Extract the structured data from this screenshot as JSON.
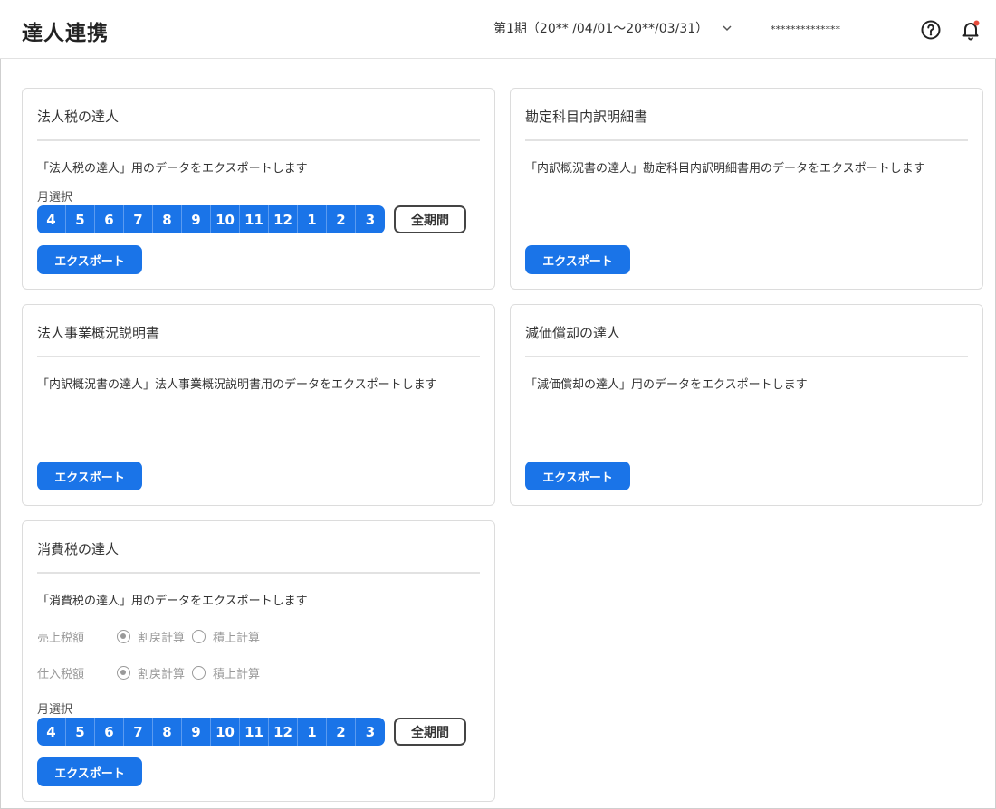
{
  "header": {
    "title": "達人連携",
    "period": "第1期（20** /04/01〜20**/03/31）",
    "company": "**************"
  },
  "months": [
    "4",
    "5",
    "6",
    "7",
    "8",
    "9",
    "10",
    "11",
    "12",
    "1",
    "2",
    "3"
  ],
  "common": {
    "month_select_label": "月選択",
    "full_period_label": "全期間",
    "export_label": "エクスポート"
  },
  "cards": {
    "corporate_tax": {
      "title": "法人税の達人",
      "desc": "「法人税の達人」用のデータをエクスポートします"
    },
    "account_detail": {
      "title": "勘定科目内訳明細書",
      "desc": "「内訳概況書の達人」勘定科目内訳明細書用のデータをエクスポートします"
    },
    "business_overview": {
      "title": "法人事業概況説明書",
      "desc": "「内訳概況書の達人」法人事業概況説明書用のデータをエクスポートします"
    },
    "depreciation": {
      "title": "減価償却の達人",
      "desc": "「減価償却の達人」用のデータをエクスポートします"
    },
    "consumption_tax": {
      "title": "消費税の達人",
      "desc": "「消費税の達人」用のデータをエクスポートします",
      "sales_tax_label": "売上税額",
      "purchase_tax_label": "仕入税額",
      "option_split": "割戻計算",
      "option_stack": "積上計算"
    }
  },
  "colors": {
    "accent": "#1a74e8",
    "border": "#dcdcdc",
    "notification_dot": "#e74c3c"
  }
}
